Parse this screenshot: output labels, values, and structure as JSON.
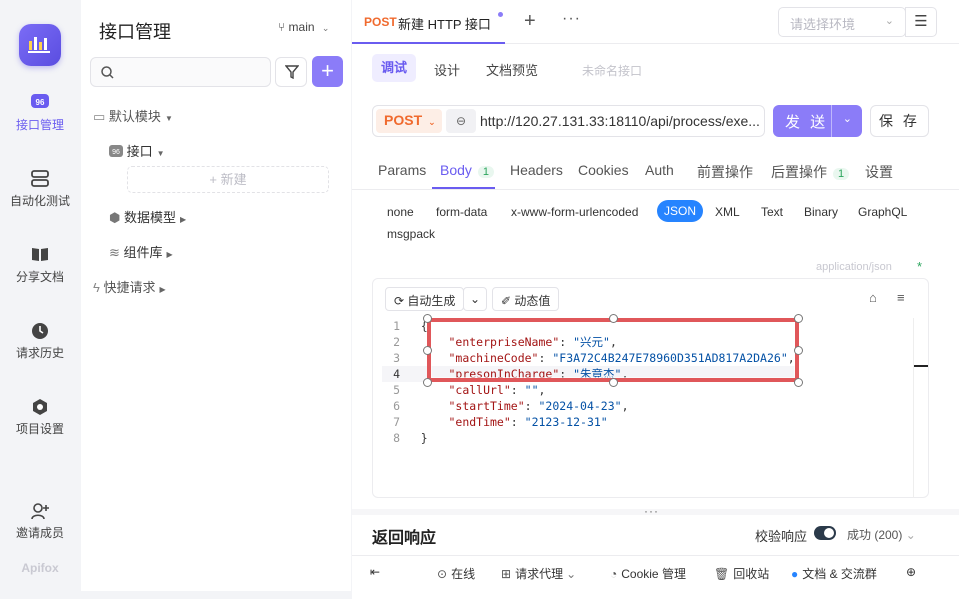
{
  "rail": {
    "items": [
      {
        "label": "接口管理",
        "icon": "api-badge-icon",
        "active": true
      },
      {
        "label": "自动化测试",
        "icon": "stack-icon"
      },
      {
        "label": "分享文档",
        "icon": "book-icon"
      },
      {
        "label": "请求历史",
        "icon": "clock-icon"
      },
      {
        "label": "项目设置",
        "icon": "gear-icon"
      },
      {
        "label": "邀请成员",
        "icon": "add-user-icon"
      }
    ],
    "brand": "Apifox"
  },
  "sidebar": {
    "title": "接口管理",
    "branch": "main",
    "tree": {
      "default_module": "默认模块",
      "api_folder": "接口",
      "new_label": "+ 新建",
      "data_models": "数据模型",
      "components": "组件库",
      "quick_request": "快捷请求"
    }
  },
  "tab": {
    "method": "POST",
    "title": "新建 HTTP 接口",
    "env_placeholder": "请选择环境"
  },
  "subtabs": {
    "debug": "调试",
    "design": "设计",
    "doc_preview": "文档预览",
    "unnamed": "未命名接口"
  },
  "request": {
    "method": "POST",
    "url": "http://120.27.131.33:18110/api/process/exe...",
    "send_label": "发 送",
    "save_label": "保 存"
  },
  "req_tabs": {
    "params": "Params",
    "body": "Body",
    "body_count": "1",
    "headers": "Headers",
    "cookies": "Cookies",
    "auth": "Auth",
    "pre": "前置操作",
    "post": "后置操作",
    "post_count": "1",
    "settings": "设置"
  },
  "body_types": {
    "none": "none",
    "form_data": "form-data",
    "urlencoded": "x-www-form-urlencoded",
    "json": "JSON",
    "xml": "XML",
    "text": "Text",
    "binary": "Binary",
    "graphql": "GraphQL",
    "msgpack": "msgpack"
  },
  "content_type": "application/json",
  "editor": {
    "auto_gen": "自动生成",
    "dynamic": "动态值",
    "lines": [
      {
        "n": "1",
        "text": "{"
      },
      {
        "n": "2",
        "key": "\"enterpriseName\"",
        "val": "\"兴元\""
      },
      {
        "n": "3",
        "key": "\"machineCode\"",
        "val": "\"F3A72C4B247E78960D351AD817A2DA26\""
      },
      {
        "n": "4",
        "key": "\"presonInCharge\"",
        "val": "\"朱竟杰\""
      },
      {
        "n": "5",
        "key": "\"callUrl\"",
        "val": "\"\""
      },
      {
        "n": "6",
        "key": "\"startTime\"",
        "val": "\"2024-04-23\""
      },
      {
        "n": "7",
        "key": "\"endTime\"",
        "val": "\"2123-12-31\""
      },
      {
        "n": "8",
        "text": "}"
      }
    ]
  },
  "response": {
    "title": "返回响应",
    "verify": "校验响应",
    "status": "成功 (200)"
  },
  "footer": {
    "online": "在线",
    "proxy": "请求代理",
    "cookie": "Cookie 管理",
    "recycle": "回收站",
    "docs": "文档 & 交流群"
  }
}
